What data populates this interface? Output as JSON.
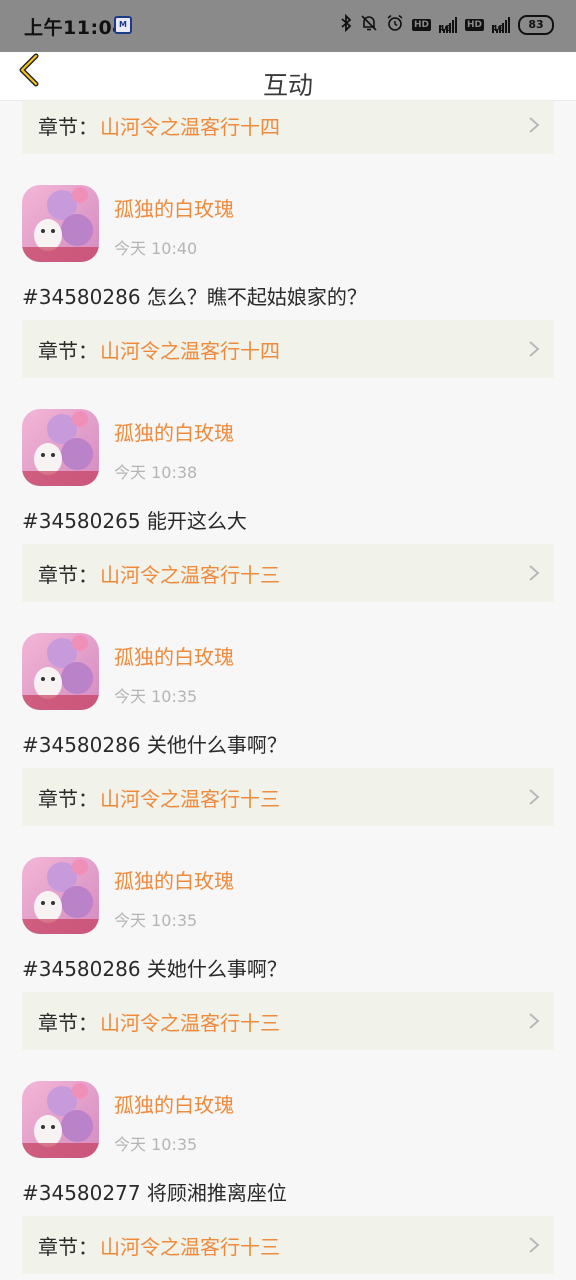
{
  "status_bar": {
    "time": "上午11:04",
    "battery": "83",
    "net1": "4G",
    "net2": "4G",
    "hd": "HD"
  },
  "header": {
    "title": "互动"
  },
  "chapter_label": "章节：",
  "items": [
    {
      "chapter": "山河令之温客行十四"
    },
    {
      "username": "孤独的白玫瑰",
      "time": "今天 10:40",
      "comment": "#34580286 怎么？瞧不起姑娘家的？",
      "chapter": "山河令之温客行十四"
    },
    {
      "username": "孤独的白玫瑰",
      "time": "今天 10:38",
      "comment": "#34580265 能开这么大",
      "chapter": "山河令之温客行十三"
    },
    {
      "username": "孤独的白玫瑰",
      "time": "今天 10:35",
      "comment": "#34580286 关他什么事啊？",
      "chapter": "山河令之温客行十三"
    },
    {
      "username": "孤独的白玫瑰",
      "time": "今天 10:35",
      "comment": "#34580286 关她什么事啊？",
      "chapter": "山河令之温客行十三"
    },
    {
      "username": "孤独的白玫瑰",
      "time": "今天 10:35",
      "comment": "#34580277 将顾湘推离座位",
      "chapter": "山河令之温客行十三"
    }
  ],
  "colors": {
    "accent": "#ef8a3c",
    "row_bg": "#f1f2ea",
    "status_bar": "#8a8a8a"
  }
}
